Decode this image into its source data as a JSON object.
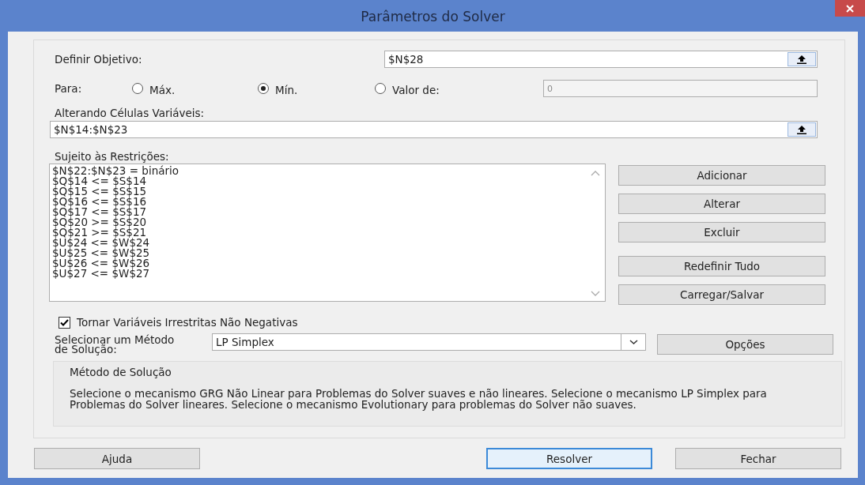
{
  "window": {
    "title": "Parâmetros do Solver"
  },
  "objective": {
    "label": "Definir Objetivo:",
    "value": "$N$28"
  },
  "para": {
    "label": "Para:",
    "options": [
      {
        "label": "Máx.",
        "selected": false
      },
      {
        "label": "Mín.",
        "selected": true
      },
      {
        "label": "Valor de:",
        "selected": false
      }
    ],
    "value_field": {
      "value": "0",
      "disabled": true
    }
  },
  "variables": {
    "label": "Alterando Células Variáveis:",
    "value": "$N$14:$N$23"
  },
  "constraints": {
    "label": "Sujeito às Restrições:",
    "items": [
      "$N$22:$N$23 = binário",
      "$Q$14 <= $S$14",
      "$Q$15 <= $S$15",
      "$Q$16 <= $S$16",
      "$Q$17 <= $S$17",
      "$Q$20 >= $S$20",
      "$Q$21 >= $S$21",
      "$U$24 <= $W$24",
      "$U$25 <= $W$25",
      "$U$26 <= $W$26",
      "$U$27 <= $W$27"
    ]
  },
  "constraint_buttons": [
    "Adicionar",
    "Alterar",
    "Excluir",
    "Redefinir Tudo",
    "Carregar/Salvar"
  ],
  "nonnegative": {
    "label": "Tornar Variáveis Irrestritas Não Negativas",
    "checked": true
  },
  "method": {
    "label": "Selecionar um Método de Solução:",
    "value": "LP Simplex",
    "options_button": "Opções"
  },
  "description": {
    "title": "Método de Solução",
    "text": "Selecione o mecanismo GRG Não Linear para Problemas do Solver suaves e não lineares. Selecione o mecanismo LP Simplex para Problemas do Solver lineares. Selecione o mecanismo Evolutionary para problemas do Solver não suaves."
  },
  "footer_buttons": [
    {
      "label": "Ajuda",
      "focused": false
    },
    {
      "label": "Resolver",
      "focused": true
    },
    {
      "label": "Fechar",
      "focused": false
    }
  ]
}
